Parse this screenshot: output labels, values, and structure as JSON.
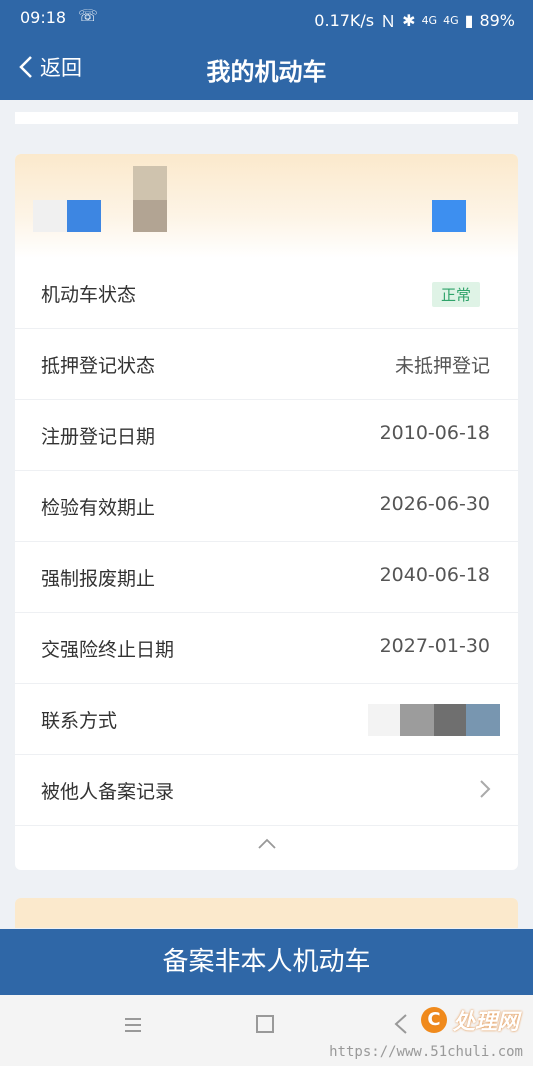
{
  "status_bar": {
    "time": "09:18",
    "speed": "0.17K/s",
    "signal_a": "4G",
    "signal_b": "4G",
    "battery": "89%"
  },
  "nav": {
    "back_label": "返回",
    "title": "我的机动车"
  },
  "vehicle": {
    "rows": [
      {
        "label": "机动车状态",
        "value": "正常"
      },
      {
        "label": "抵押登记状态",
        "value": "未抵押登记"
      },
      {
        "label": "注册登记日期",
        "value": "2010-06-18"
      },
      {
        "label": "检验有效期止",
        "value": "2026-06-30"
      },
      {
        "label": "强制报废期止",
        "value": "2040-06-18"
      },
      {
        "label": "交强险终止日期",
        "value": "2027-01-30"
      },
      {
        "label": "联系方式",
        "value": ""
      },
      {
        "label": "被他人备案记录",
        "value": ""
      }
    ]
  },
  "bottom_button": {
    "label": "备案非本人机动车"
  },
  "watermark": {
    "logo_text": "处理网",
    "url": "https://www.51chuli.com"
  },
  "colors": {
    "brand": "#2f67a7",
    "badge_bg": "#dff3e6",
    "badge_text": "#2fa36a"
  }
}
